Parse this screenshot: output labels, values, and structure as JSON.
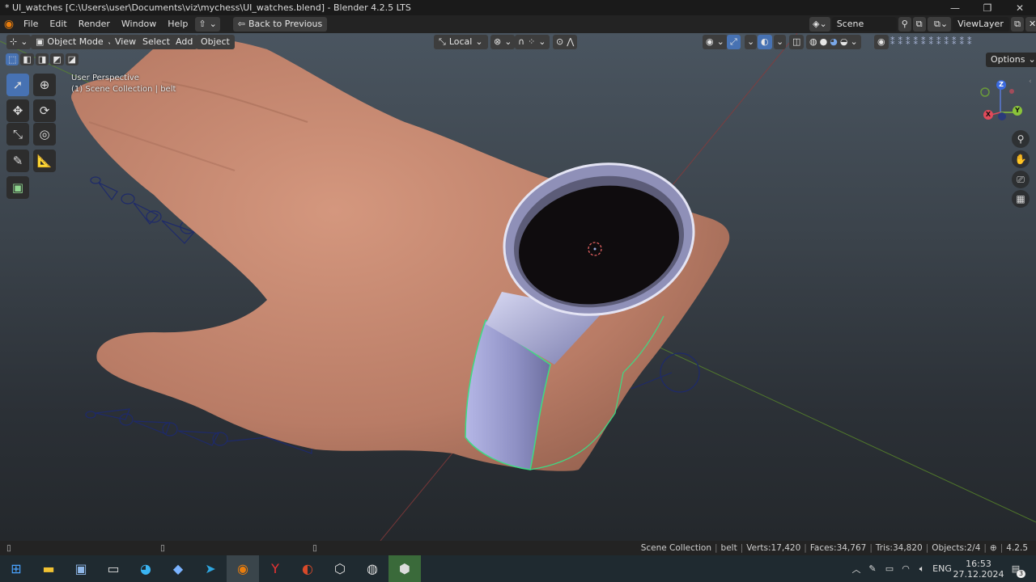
{
  "window": {
    "title": "* UI_watches [C:\\Users\\user\\Documents\\viz\\mychess\\UI_watches.blend] - Blender 4.2.5 LTS",
    "minimize_glyph": "—",
    "maximize_glyph": "❐",
    "close_glyph": "✕"
  },
  "menubar": {
    "items": [
      "File",
      "Edit",
      "Render",
      "Window",
      "Help"
    ],
    "back_button": "Back to Previous",
    "scene_label": "Scene",
    "viewlayer_label": "ViewLayer"
  },
  "viewport_header": {
    "mode": "Object Mode",
    "menus": [
      "View",
      "Select",
      "Add",
      "Object"
    ],
    "transform_orientation": "Local",
    "options_label": "Options"
  },
  "viewport_overlay": {
    "perspective": "User Perspective",
    "collection_info": "(1) Scene Collection | belt"
  },
  "gizmo": {
    "x": "X",
    "y": "Y",
    "z": "Z"
  },
  "statusbar": {
    "collection": "Scene Collection",
    "object": "belt",
    "verts": "Verts:17,420",
    "faces": "Faces:34,767",
    "tris": "Tris:34,820",
    "objects": "Objects:2/4",
    "version": "4.2.5"
  },
  "taskbar": {
    "lang": "ENG",
    "time": "16:53",
    "date": "27.12.2024",
    "notification_count": "3"
  },
  "colors": {
    "accent": "#4772b3",
    "selection_outline": "#3ddc84",
    "skin": "#c88a72",
    "watch_metal": "#9c9fc8"
  }
}
